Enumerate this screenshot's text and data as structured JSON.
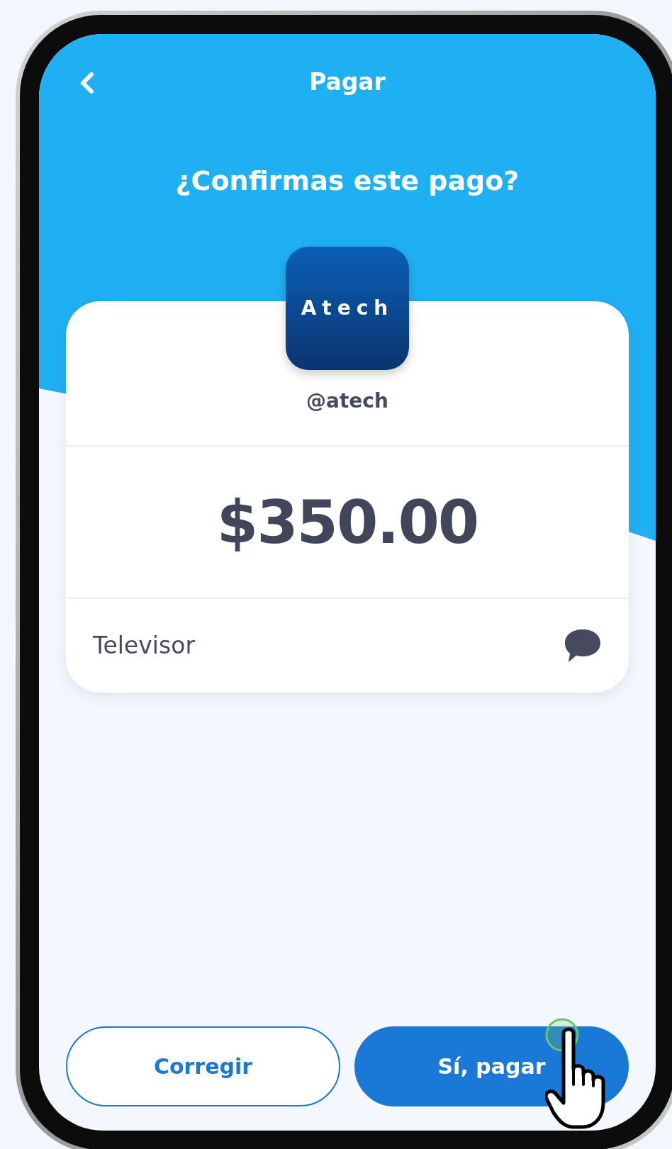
{
  "header": {
    "title": "Pagar"
  },
  "question": "¿Confirmas este pago?",
  "merchant": {
    "logo_text": "Atech",
    "handle": "@atech"
  },
  "amount": "$350.00",
  "concept": "Televisor",
  "buttons": [
    {
      "label": "Corregir",
      "kind": "secondary"
    },
    {
      "label": "Sí, pagar",
      "kind": "primary"
    }
  ]
}
